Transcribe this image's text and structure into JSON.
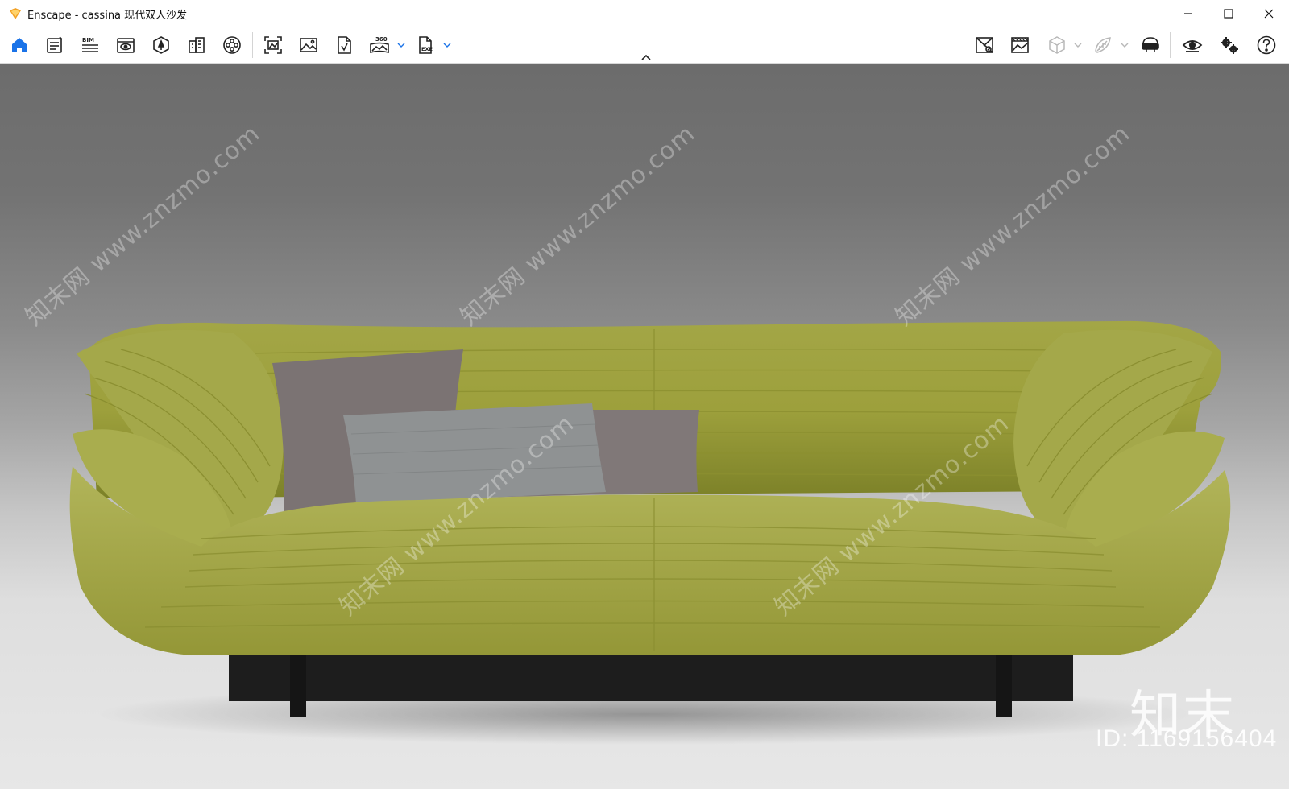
{
  "window": {
    "title": "Enscape - cassina 现代双人沙发",
    "minimize_icon": "minimize-icon",
    "maximize_icon": "maximize-icon",
    "close_icon": "close-icon"
  },
  "toolbar": {
    "left_icons": [
      "home-icon",
      "settings-panel-icon",
      "bim-icon",
      "visual-settings-icon",
      "asset-library-icon",
      "material-editor-icon",
      "video-editor-icon",
      "screenshot-icon",
      "batch-render-icon",
      "web-standalone-icon",
      "panorama-360-icon",
      "export-icon"
    ],
    "bim_label": "BIM",
    "panorama_label": "360",
    "export_label": "EXE",
    "right_icons": [
      "view-management-icon",
      "render-settings-icon",
      "orthographic-icon",
      "light-view-icon",
      "vr-headset-icon",
      "visibility-icon",
      "general-settings-icon",
      "help-icon"
    ],
    "active_color": "#1a73e8"
  },
  "watermark": {
    "text": "知末网 www.znzmo.com",
    "logo": "知末",
    "id_text": "ID: 1169156404"
  }
}
